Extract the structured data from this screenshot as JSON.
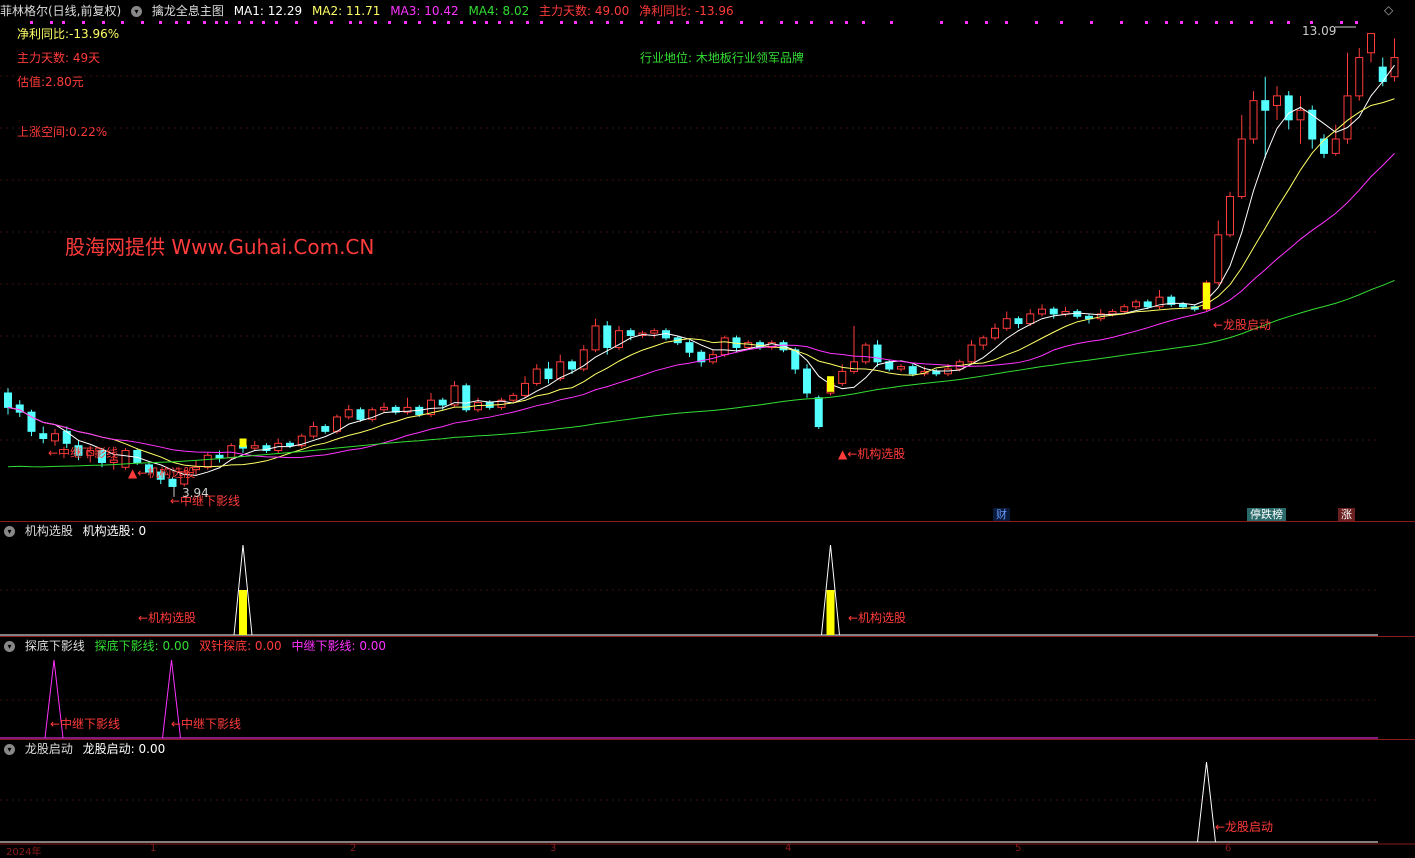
{
  "header": {
    "stock": "菲林格尔(日线,前复权)",
    "indicator": "擒龙全息主图",
    "ma1": "MA1: 12.29",
    "ma2": "MA2: 11.71",
    "ma3": "MA3: 10.42",
    "ma4": "MA4: 8.02",
    "days": "主力天数: 49.00",
    "yoy": "净利同比: -13.96",
    "diamond": "◇"
  },
  "info": {
    "yoy": "净利同比:-13.96%",
    "days": "主力天数: 49天",
    "val": "估值:2.80元",
    "up": "上涨空间:0.22%",
    "industry": "行业地位: 木地板行业领军品牌",
    "watermark": "股海网提供 Www.Guhai.Com.CN"
  },
  "annotations": {
    "zhongji1": "←中继下影线",
    "jigou1": "▲←机构选股",
    "zhongji2": "←中继下影线",
    "low": "3.94",
    "jigou2": "▲←机构选股",
    "longgu": "←龙股启动",
    "high": "13.09"
  },
  "badges": {
    "cai": "财",
    "ting": "停跌榜",
    "zhang": "涨"
  },
  "panels": {
    "p1_title": "机构选股",
    "p1_value": "机构选股: 0",
    "p1_lbl": "←机构选股",
    "p2_title": "探底下影线",
    "p2_v1": "探底下影线: 0.00",
    "p2_v2": "双针探底: 0.00",
    "p2_v3": "中继下影线: 0.00",
    "p2_lbl": "←中继下影线",
    "p3_title": "龙股启动",
    "p3_value": "龙股启动: 0.00",
    "p3_lbl": "←龙股启动"
  },
  "axis": {
    "start": "2024年",
    "m1": "1",
    "m2": "2",
    "m3": "3",
    "m4": "4",
    "m5": "5",
    "m6": "6"
  },
  "colors": {
    "up": "#ff3b3b",
    "down": "#54ffff",
    "ma1": "#ffffff",
    "ma2": "#ffff66",
    "ma3": "#ff33ff",
    "ma4": "#33dd33",
    "signal": "#ffff00"
  },
  "chart_data": {
    "type": "candlestick",
    "ylim": [
      3.5,
      13.6
    ],
    "candles": [
      [
        5.9,
        5.6,
        6.0,
        5.45
      ],
      [
        5.65,
        5.5,
        5.75,
        5.4
      ],
      [
        5.5,
        5.1,
        5.55,
        5.0
      ],
      [
        5.05,
        4.95,
        5.2,
        4.85
      ],
      [
        4.9,
        5.05,
        5.15,
        4.8
      ],
      [
        5.1,
        4.85,
        5.2,
        4.75
      ],
      [
        4.8,
        4.6,
        4.9,
        4.5
      ],
      [
        4.6,
        4.7,
        4.8,
        4.45
      ],
      [
        4.7,
        4.45,
        4.75,
        4.35
      ],
      [
        4.45,
        4.5,
        4.6,
        4.3
      ],
      [
        4.35,
        4.7,
        4.75,
        4.3
      ],
      [
        4.7,
        4.45,
        4.75,
        4.4
      ],
      [
        4.4,
        4.25,
        4.45,
        4.2
      ],
      [
        4.25,
        4.1,
        4.3,
        4.0
      ],
      [
        4.1,
        3.95,
        4.15,
        3.94
      ],
      [
        4.0,
        4.25,
        4.3,
        3.95
      ],
      [
        4.3,
        4.35,
        4.5,
        4.2
      ],
      [
        4.35,
        4.6,
        4.65,
        4.3
      ],
      [
        4.6,
        4.55,
        4.7,
        4.45
      ],
      [
        4.55,
        4.8,
        4.85,
        4.5
      ],
      [
        4.8,
        4.75,
        4.85,
        4.65
      ],
      [
        4.75,
        4.8,
        4.9,
        4.7
      ],
      [
        4.8,
        4.7,
        4.85,
        4.65
      ],
      [
        4.7,
        4.85,
        4.95,
        4.65
      ],
      [
        4.85,
        4.8,
        4.9,
        4.75
      ],
      [
        4.8,
        5.0,
        5.05,
        4.75
      ],
      [
        5.0,
        5.2,
        5.3,
        4.95
      ],
      [
        5.2,
        5.1,
        5.25,
        5.05
      ],
      [
        5.1,
        5.4,
        5.45,
        5.05
      ],
      [
        5.4,
        5.55,
        5.65,
        5.35
      ],
      [
        5.55,
        5.35,
        5.6,
        5.3
      ],
      [
        5.35,
        5.55,
        5.6,
        5.3
      ],
      [
        5.55,
        5.6,
        5.7,
        5.5
      ],
      [
        5.6,
        5.5,
        5.65,
        5.45
      ],
      [
        5.5,
        5.6,
        5.8,
        5.45
      ],
      [
        5.6,
        5.45,
        5.65,
        5.4
      ],
      [
        5.45,
        5.75,
        5.9,
        5.4
      ],
      [
        5.75,
        5.65,
        5.8,
        5.55
      ],
      [
        5.65,
        6.05,
        6.15,
        5.6
      ],
      [
        6.05,
        5.55,
        6.1,
        5.5
      ],
      [
        5.55,
        5.7,
        5.8,
        5.5
      ],
      [
        5.7,
        5.6,
        5.75,
        5.55
      ],
      [
        5.6,
        5.75,
        5.8,
        5.55
      ],
      [
        5.75,
        5.85,
        5.9,
        5.7
      ],
      [
        5.85,
        6.1,
        6.25,
        5.8
      ],
      [
        6.1,
        6.4,
        6.5,
        6.05
      ],
      [
        6.4,
        6.2,
        6.55,
        6.1
      ],
      [
        6.2,
        6.55,
        6.7,
        6.15
      ],
      [
        6.55,
        6.4,
        6.6,
        6.3
      ],
      [
        6.4,
        6.8,
        6.9,
        6.35
      ],
      [
        6.8,
        7.3,
        7.45,
        6.75
      ],
      [
        7.3,
        6.85,
        7.4,
        6.7
      ],
      [
        6.85,
        7.2,
        7.3,
        6.8
      ],
      [
        7.2,
        7.1,
        7.25,
        7.0
      ],
      [
        7.1,
        7.15,
        7.2,
        7.05
      ],
      [
        7.15,
        7.2,
        7.25,
        7.05
      ],
      [
        7.2,
        7.05,
        7.25,
        7.0
      ],
      [
        7.05,
        6.95,
        7.1,
        6.9
      ],
      [
        6.95,
        6.75,
        7.0,
        6.65
      ],
      [
        6.75,
        6.55,
        6.8,
        6.45
      ],
      [
        6.55,
        6.7,
        6.8,
        6.5
      ],
      [
        6.7,
        7.05,
        7.1,
        6.65
      ],
      [
        7.05,
        6.85,
        7.1,
        6.75
      ],
      [
        6.85,
        6.95,
        7.0,
        6.8
      ],
      [
        6.95,
        6.85,
        7.0,
        6.8
      ],
      [
        6.85,
        6.95,
        7.0,
        6.8
      ],
      [
        6.95,
        6.8,
        7.0,
        6.75
      ],
      [
        6.8,
        6.4,
        6.85,
        6.3
      ],
      [
        6.4,
        5.9,
        6.5,
        5.8
      ],
      [
        5.8,
        5.2,
        5.85,
        5.15
      ],
      [
        5.9,
        6.1,
        6.2,
        5.85
      ],
      [
        6.1,
        6.35,
        6.5,
        6.05
      ],
      [
        6.35,
        6.55,
        7.3,
        6.3
      ],
      [
        6.55,
        6.9,
        6.95,
        6.5
      ],
      [
        6.9,
        6.55,
        7.0,
        6.45
      ],
      [
        6.55,
        6.4,
        6.6,
        6.35
      ],
      [
        6.4,
        6.45,
        6.5,
        6.35
      ],
      [
        6.45,
        6.3,
        6.5,
        6.25
      ],
      [
        6.3,
        6.35,
        6.45,
        6.25
      ],
      [
        6.35,
        6.3,
        6.4,
        6.25
      ],
      [
        6.3,
        6.4,
        6.5,
        6.25
      ],
      [
        6.4,
        6.55,
        6.6,
        6.35
      ],
      [
        6.55,
        6.9,
        7.0,
        6.5
      ],
      [
        6.9,
        7.05,
        7.1,
        6.8
      ],
      [
        7.05,
        7.25,
        7.35,
        7.0
      ],
      [
        7.25,
        7.45,
        7.6,
        7.2
      ],
      [
        7.45,
        7.35,
        7.5,
        7.25
      ],
      [
        7.35,
        7.55,
        7.65,
        7.3
      ],
      [
        7.55,
        7.65,
        7.75,
        7.5
      ],
      [
        7.65,
        7.55,
        7.7,
        7.45
      ],
      [
        7.55,
        7.6,
        7.7,
        7.5
      ],
      [
        7.6,
        7.5,
        7.65,
        7.45
      ],
      [
        7.5,
        7.45,
        7.55,
        7.35
      ],
      [
        7.45,
        7.55,
        7.65,
        7.4
      ],
      [
        7.55,
        7.6,
        7.65,
        7.5
      ],
      [
        7.6,
        7.7,
        7.75,
        7.55
      ],
      [
        7.7,
        7.8,
        7.85,
        7.65
      ],
      [
        7.8,
        7.7,
        7.85,
        7.65
      ],
      [
        7.7,
        7.9,
        8.05,
        7.65
      ],
      [
        7.9,
        7.75,
        7.95,
        7.7
      ],
      [
        7.75,
        7.7,
        7.8,
        7.65
      ],
      [
        7.7,
        7.65,
        7.75,
        7.6
      ],
      [
        7.65,
        8.2,
        8.25,
        7.6
      ],
      [
        8.2,
        9.2,
        9.5,
        8.15
      ],
      [
        9.2,
        10.0,
        10.1,
        9.15
      ],
      [
        10.0,
        11.2,
        11.7,
        9.95
      ],
      [
        11.2,
        12.0,
        12.2,
        11.1
      ],
      [
        12.0,
        11.8,
        12.5,
        10.8
      ],
      [
        11.9,
        12.1,
        12.3,
        11.6
      ],
      [
        12.1,
        11.6,
        12.2,
        11.4
      ],
      [
        11.6,
        11.8,
        12.1,
        11.1
      ],
      [
        11.8,
        11.2,
        11.9,
        11.0
      ],
      [
        11.2,
        10.9,
        11.3,
        10.8
      ],
      [
        10.9,
        11.2,
        11.5,
        10.85
      ],
      [
        11.2,
        12.1,
        13.0,
        11.1
      ],
      [
        12.1,
        12.9,
        13.1,
        12.0
      ],
      [
        13.0,
        13.4,
        13.4,
        12.8
      ],
      [
        12.7,
        12.4,
        12.9,
        12.3
      ],
      [
        12.5,
        12.9,
        13.3,
        12.4
      ]
    ],
    "signals": {
      "jigou": [
        20,
        70
      ],
      "longgu": [
        102
      ]
    },
    "low_label": 3.94,
    "high_label": 13.09
  }
}
